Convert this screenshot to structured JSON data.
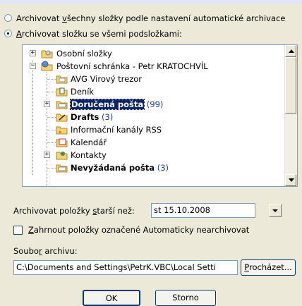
{
  "options": {
    "archive_all_label_pre": "Archivovat ",
    "archive_all_label_u": "v",
    "archive_all_label_post": "šechny složky podle nastavení automatické archivace",
    "archive_folder_label_u": "A",
    "archive_folder_label_post": "rchivovat složku se všemi podsložkami:"
  },
  "tree": {
    "items": [
      {
        "name": "Osobní složky",
        "count": ""
      },
      {
        "name": "Poštovní schránka - Petr KRATOCHVÍL",
        "count": ""
      },
      {
        "name": "AVG Virový trezor",
        "count": ""
      },
      {
        "name": "Deník",
        "count": ""
      },
      {
        "name": "Doručená pošta",
        "count": "(99)"
      },
      {
        "name": "Drafts",
        "count": "(3)"
      },
      {
        "name": "Informační kanály RSS",
        "count": ""
      },
      {
        "name": "Kalendář",
        "count": ""
      },
      {
        "name": "Kontakty",
        "count": ""
      },
      {
        "name": "Nevyžádaná pošta",
        "count": "(3)"
      }
    ],
    "expander_plus": "+",
    "expander_minus": "−"
  },
  "older_than": {
    "label_pre": "Archivovat položky ",
    "label_u": "s",
    "label_post": "tarší než:",
    "value": "st 15.10.2008"
  },
  "include_checkbox": {
    "label_u": "Z",
    "label_post": "ahrnout položky označené Automaticky nearchivovat",
    "checked": false
  },
  "archive_file": {
    "label_pre": "Soubo",
    "label_u": "r",
    "label_post": " archivu:",
    "value": "C:\\Documents and Settings\\PetrK.VBC\\Local Setti",
    "browse_u": "P",
    "browse_post": "rocházet..."
  },
  "buttons": {
    "ok": "OK",
    "cancel": "Storno"
  },
  "colors": {
    "dialog_bg": "#ece9d8",
    "selection": "#0a246a",
    "count_blue": "#1a3fa6"
  }
}
